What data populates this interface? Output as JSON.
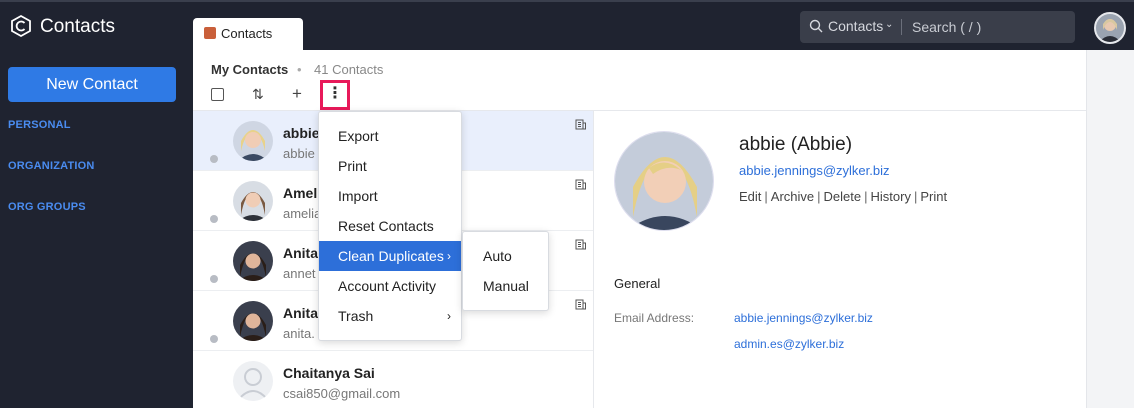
{
  "app": {
    "title": "Contacts"
  },
  "search": {
    "scope": "Contacts",
    "placeholder": "Search ( / )"
  },
  "sidebar": {
    "new_contact_label": "New Contact",
    "links": [
      "PERSONAL",
      "ORGANIZATION",
      "ORG GROUPS"
    ]
  },
  "tab": {
    "label": "Contacts"
  },
  "list_header": {
    "title": "My Contacts",
    "dot": "•",
    "count": "41 Contacts"
  },
  "toolbar": {
    "sort_glyph": "⇅",
    "add_glyph": "+",
    "more_glyph": "⋮"
  },
  "contacts": [
    {
      "name": "abbie",
      "email": "abbie",
      "selected": true
    },
    {
      "name": "Ameli",
      "email": "amelia",
      "selected": false
    },
    {
      "name": "Anita",
      "email": "annet",
      "selected": false
    },
    {
      "name": "Anita",
      "email": "anita.",
      "selected": false
    },
    {
      "name": "Chaitanya Sai",
      "email": "csai850@gmail.com",
      "selected": false
    }
  ],
  "menu": {
    "items": [
      "Export",
      "Print",
      "Import",
      "Reset Contacts",
      "Clean Duplicates",
      "Account Activity",
      "Trash"
    ],
    "submenu_arrow": "›",
    "submenu": [
      "Auto",
      "Manual"
    ]
  },
  "detail": {
    "name": "abbie (Abbie)",
    "email": "abbie.jennings@zylker.biz",
    "actions": [
      "Edit",
      "Archive",
      "Delete",
      "History",
      "Print"
    ],
    "section": "General",
    "email_label": "Email Address:",
    "emails": [
      "abbie.jennings@zylker.biz",
      "admin.es@zylker.biz"
    ]
  },
  "colors": {
    "accent": "#2f7ae5",
    "highlight_border": "#e8195a",
    "sidebar_bg": "#1f2330",
    "link": "#2d6fd9"
  },
  "icons": {
    "logo": "contacts-logo-icon",
    "search": "search-icon",
    "org": "building-icon"
  }
}
